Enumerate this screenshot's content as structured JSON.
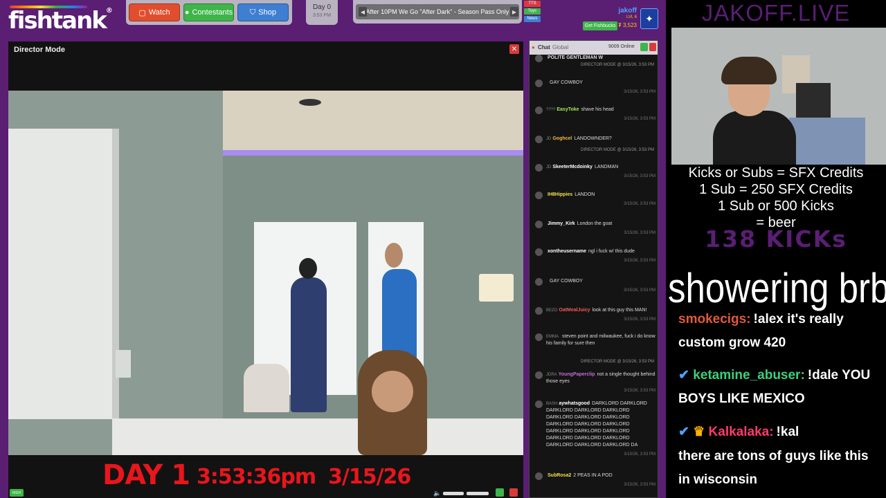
{
  "header": {
    "logo": "fishtank",
    "nav": {
      "watch": "Watch",
      "contestants": "Contestants",
      "shop": "Shop"
    },
    "day": {
      "label": "Day 0",
      "time": "3:53 PM"
    },
    "ticker": "After 10PM We Go \"After Dark\" - Season Pass Only",
    "badges": {
      "tts": "TTS",
      "toys": "Toys",
      "news": "News"
    },
    "user": {
      "name": "jakoff",
      "level": "LVL 6",
      "coins": "₮ 3,523",
      "fishbucks": "Get Fishbucks"
    }
  },
  "director": {
    "title": "Director Mode",
    "overlay": {
      "day": "DAY 1",
      "time": "3:53:36pm",
      "date": "3/15/26"
    },
    "quality": "HIGH"
  },
  "chat": {
    "title": "Chat",
    "tab": "Global",
    "online": "9009 Online",
    "messages": [
      {
        "tag": "",
        "user": "POLITE GENTLEMAN W",
        "text": "",
        "ts": "",
        "color": "#dddddd"
      },
      {
        "sys": "DIRECTOR MODE @ 3/15/26, 3:53 PM"
      },
      {
        "tag": "",
        "user": "",
        "text": "GAY COWBOY",
        "ts": "3/15/26, 3:53 PM",
        "color": "#dddddd"
      },
      {
        "tag": "????",
        "user": "EasyToke",
        "text": "shave his head",
        "ts": "3/15/26, 3:53 PM",
        "color": "#a6e35b"
      },
      {
        "tag": "JD",
        "user": "Goghcel",
        "text": "LANDOWNDER?",
        "ts": "",
        "color": "#f2b84a"
      },
      {
        "sys": "DIRECTOR MODE @ 3/15/26, 3:53 PM"
      },
      {
        "tag": "JD",
        "user": "SkeeterMcdoinky",
        "text": "LANDMAN",
        "ts": "3/15/26, 3:53 PM",
        "color": "#ffffff"
      },
      {
        "tag": "",
        "user": "IH8Hippies",
        "text": "LANDON",
        "ts": "3/15/26, 3:53 PM",
        "color": "#f2e34a"
      },
      {
        "tag": "",
        "user": "Jimmy_Kirk",
        "text": "London the goat",
        "ts": "3/15/26, 3:53 PM",
        "color": "#ffffff"
      },
      {
        "tag": "",
        "user": "xontheusername",
        "text": "ngl i fuck w/ this dude",
        "ts": "3/15/26, 3:53 PM",
        "color": "#ffffff"
      },
      {
        "tag": "",
        "user": "",
        "text": "GAY COWBOY",
        "ts": "3/15/26, 3:53 PM",
        "color": "#dddddd"
      },
      {
        "tag": "BEZO",
        "user": "OatMealJuicy",
        "text": "look at this guy this MAN!",
        "ts": "3/15/26, 3:53 PM",
        "color": "#f25a5a"
      },
      {
        "tag": "EMMA",
        "user": "",
        "text": "steven point and milwaukee, fuck i do know his family for sure then",
        "ts": "",
        "color": "#dddddd"
      },
      {
        "sys": "DIRECTOR MODE @ 3/15/26, 3:53 PM"
      },
      {
        "tag": "JDRA",
        "user": "YoungPaperclip",
        "text": "not a single thought behind those eyes",
        "ts": "3/15/26, 3:53 PM",
        "color": "#c46bd9"
      },
      {
        "tag": "BASH",
        "user": "aywhatsgood",
        "text": "DARKLORD DARKLORD DARKLORD DARKLORD DARKLORD DARKLORD DARKLORD DARKLORD DARKLORD DARKLORD DARKLORD DARKLORD DARKLORD DARKLORD DARKLORD DARKLORD DARKLORD DARKLORD DARKLORD DARKLORD DA",
        "ts": "3/15/26, 3:53 PM",
        "color": "#ffffff"
      },
      {
        "tag": "",
        "user": "SubRosa2",
        "text": "2 PEAS IN A POD",
        "ts": "3/15/26, 3:53 PM",
        "color": "#f2e34a"
      }
    ]
  },
  "stream": {
    "title": "JAKOFF.LIVE",
    "promo": [
      "Kicks or Subs = SFX Credits",
      "1 Sub = 250 SFX Credits",
      "1 Sub or 500 Kicks",
      "= beer"
    ],
    "kicks": "138 KICKs",
    "status": "showering brb",
    "chat": [
      {
        "user": "smokecigs:",
        "text": "!alex it's really",
        "cont": "custom grow 420",
        "color": "#e05a3a"
      },
      {
        "user": "ketamine_abuser:",
        "text": "!dale YOU",
        "cont": "BOYS LIKE MEXICO",
        "color": "#3ad17a"
      },
      {
        "user": "Kalkalaka:",
        "text": "!kal",
        "cont": "there are tons of guys like this",
        "cont2": "in wisconsin",
        "color": "#ff3b6b"
      }
    ]
  }
}
